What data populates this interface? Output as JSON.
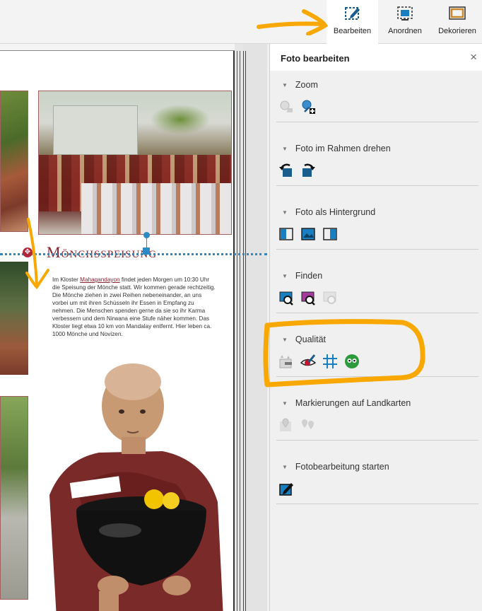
{
  "toolbar": {
    "edit_label": "Bearbeiten",
    "arrange_label": "Anordnen",
    "decorate_label": "Dekorieren"
  },
  "document": {
    "title": "Mönchsspeisung",
    "body_before": "Im Kloster ",
    "body_link": "Mahagandayon",
    "body_after": " findet jeden Morgen um 10:30 Uhr die Speisung der Mönche statt. Wir kommen gerade rechtzeitig. Die Mönche ziehen in zwei Reihen nebeneinander, an uns vorbei um mit ihren Schüsseln ihr Essen in Empfang zu nehmen. Die Menschen spenden gerne da sie so ihr Karma verbessern und dem Nirwana eine Stufe näher kommen. Das Kloster liegt etwa 10 km von Mandalay entfernt. Hier leben ca. 1000 Mönche und Novizen."
  },
  "panel": {
    "title": "Foto bearbeiten",
    "close": "×",
    "sections": [
      {
        "label": "Zoom"
      },
      {
        "label": "Foto im Rahmen drehen"
      },
      {
        "label": "Foto als Hintergrund"
      },
      {
        "label": "Finden"
      },
      {
        "label": "Qualität"
      },
      {
        "label": "Markierungen auf Landkarten"
      },
      {
        "label": "Fotobearbeitung starten"
      }
    ]
  },
  "icons": {
    "zoom": [
      "zoom-out-icon",
      "zoom-in-icon"
    ],
    "rotate": [
      "rotate-left-icon",
      "rotate-right-icon"
    ],
    "background": [
      "background-left-icon",
      "background-full-icon",
      "background-right-icon"
    ],
    "find": [
      "find-photo-icon",
      "find-similar-icon",
      "find-disabled-icon"
    ],
    "quality": [
      "auto-enhance-icon",
      "red-eye-icon",
      "grid-icon",
      "face-detect-icon"
    ],
    "map": [
      "map-marker-icon",
      "map-markers-icon"
    ],
    "start": [
      "edit-photo-icon"
    ]
  },
  "colors": {
    "accent": "#1f6fa8",
    "icon_blue": "#1a5c8c",
    "annotation_orange": "#f8a800",
    "title_red": "#8a2330"
  }
}
